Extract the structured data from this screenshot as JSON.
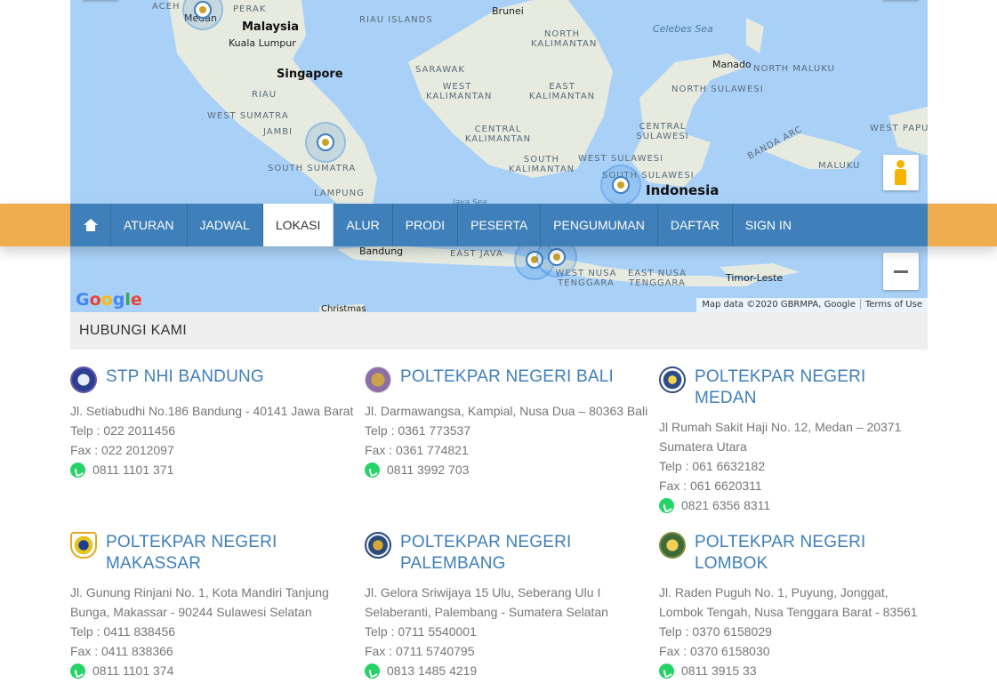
{
  "map": {
    "labels": {
      "aceh": "ACEH",
      "medan": "Medan",
      "perak": "PERAK",
      "malaysia": "Malaysia",
      "kuala_lumpur": "Kuala Lumpur",
      "riau_islands": "RIAU ISLANDS",
      "brunei": "Brunei",
      "north_kalimantan": "NORTH KALIMANTAN",
      "celebes_sea": "Celebes Sea",
      "singapore": "Singapore",
      "sarawak": "SARAWAK",
      "manado": "Manado",
      "north_maluku": "NORTH MALUKU",
      "riau": "RIAU",
      "west_kalimantan": "WEST KALIMANTAN",
      "east_kalimantan": "EAST KALIMANTAN",
      "north_sulawesi": "NORTH SULAWESI",
      "west_sumatra": "WEST SUMATRA",
      "jambi": "JAMBI",
      "central_kalimantan": "CENTRAL KALIMANTAN",
      "central_sulawesi": "CENTRAL SULAWESI",
      "west_papua": "WEST PAPUA",
      "banda_arc": "BANDA ARC",
      "south_sumatra": "SOUTH SUMATRA",
      "south_kalimantan": "SOUTH KALIMANTAN",
      "west_sulawesi": "WEST SULAWESI",
      "maluku": "MALUKU",
      "south_sulawesi": "SOUTH SULAWESI",
      "indonesia": "Indonesia",
      "lampung": "LAMPUNG",
      "java_sea": "Java Sea",
      "bandung": "Bandung",
      "east_java": "EAST JAVA",
      "west_nusa_tenggara": "WEST NUSA TENGGARA",
      "east_nusa_tenggara": "EAST NUSA TENGGARA",
      "timor_leste": "Timor-Leste",
      "christmas": "Christmas"
    },
    "google": "Google",
    "attribution": "Map data ©2020 GBRMPA, Google",
    "terms": "Terms of Use"
  },
  "nav": {
    "items": [
      "ATURAN",
      "JADWAL",
      "LOKASI",
      "ALUR",
      "PRODI",
      "PESERTA",
      "PENGUMUMAN",
      "DAFTAR",
      "SIGN IN"
    ],
    "active": "LOKASI"
  },
  "section": {
    "title": "HUBUNGI KAMI"
  },
  "contacts": [
    {
      "name": "STP NHI BANDUNG",
      "address": "Jl. Setiabudhi No.186 Bandung - 40141 Jawa Barat",
      "telp": "Telp : 022 2011456",
      "fax": "Fax : 022 2012097",
      "wa": "0811 1101 371"
    },
    {
      "name": "POLTEKPAR NEGERI BALI",
      "address": "Jl. Darmawangsa, Kampial, Nusa Dua – 80363 Bali",
      "telp": "Telp : 0361 773537",
      "fax": "Fax : 0361 774821",
      "wa": "0811 3992 703"
    },
    {
      "name": "POLTEKPAR NEGERI MEDAN",
      "address": "Jl Rumah Sakit Haji No. 12, Medan – 20371 Sumatera Utara",
      "telp": "Telp : 061 6632182",
      "fax": "Fax : 061 6620311",
      "wa": "0821 6356 8311"
    },
    {
      "name": "POLTEKPAR NEGERI MAKASSAR",
      "address": "Jl. Gunung Rinjani No. 1, Kota Mandiri Tanjung Bunga, Makassar - 90244 Sulawesi Selatan",
      "telp": "Telp : 0411 838456",
      "fax": "Fax : 0411 838366",
      "wa": "0811 1101 374"
    },
    {
      "name": "POLTEKPAR NEGERI PALEMBANG",
      "address": "Jl. Gelora Sriwijaya 15 Ulu, Seberang Ulu I Selaberanti, Palembang - Sumatera Selatan",
      "telp": "Telp : 0711 5540001",
      "fax": "Fax : 0711 5740795",
      "wa": "0813 1485 4219"
    },
    {
      "name": "POLTEKPAR NEGERI LOMBOK",
      "address": "Jl. Raden Puguh No. 1, Puyung, Jonggat, Lombok Tengah, Nusa Tenggara Barat - 83561",
      "telp": "Telp : 0370 6158029",
      "fax": "Fax : 0370 6158030",
      "wa": "0811 3915 33"
    }
  ]
}
